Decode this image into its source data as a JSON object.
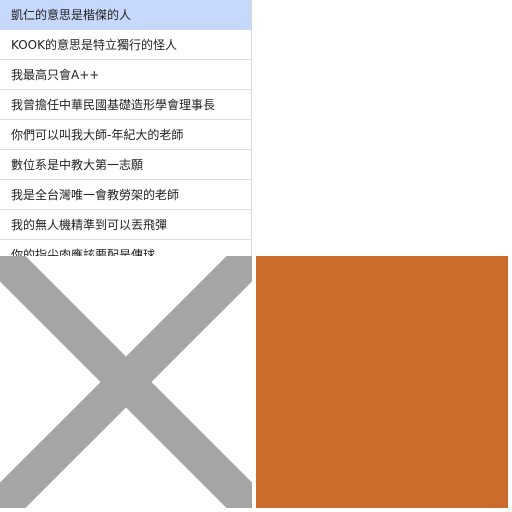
{
  "list": {
    "selected_index": 0,
    "items": [
      {
        "label": "凱仁的意思是楷傑的人"
      },
      {
        "label": "KOOK的意思是特立獨行的怪人"
      },
      {
        "label": "我最高只會A++"
      },
      {
        "label": "我曾擔任中華民國基礎造形學會理事長"
      },
      {
        "label": "你們可以叫我大師-年紀大的老師"
      },
      {
        "label": "數位系是中教大第一志願"
      },
      {
        "label": "我是全台灣唯一會教勞架的老師"
      },
      {
        "label": "我的無人機精準到可以丟飛彈"
      },
      {
        "label": "你的指尖肉應該要配是傳球"
      }
    ]
  },
  "tiles": {
    "placeholder_icon": "close-x-icon",
    "x_color": "#a5a5a3",
    "swatch_color": "#cc6c2c"
  },
  "colors": {
    "selected_bg": "#c6d9fd",
    "divider": "#dedede"
  }
}
